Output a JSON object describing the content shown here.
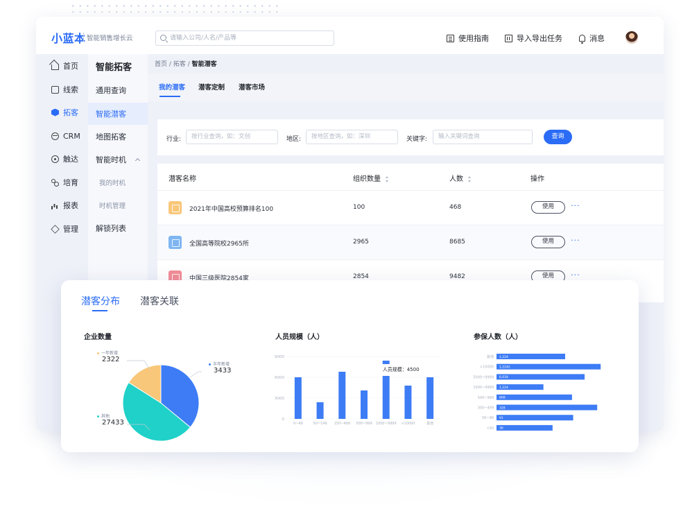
{
  "app": {
    "logo": "小蓝本",
    "subtitle": "智能销售增长云",
    "search_placeholder": "请输入公司/人名/产品等"
  },
  "toolbar": {
    "guide": "使用指南",
    "export": "导入导出任务",
    "messages": "消息"
  },
  "nav": {
    "items": [
      {
        "label": "首页",
        "icon": "home-icon"
      },
      {
        "label": "线索",
        "icon": "clue-icon"
      },
      {
        "label": "拓客",
        "icon": "prospect-icon",
        "active": true
      },
      {
        "label": "CRM",
        "icon": "crm-icon"
      },
      {
        "label": "触达",
        "icon": "reach-icon"
      },
      {
        "label": "培育",
        "icon": "nurture-icon"
      },
      {
        "label": "报表",
        "icon": "report-icon"
      },
      {
        "label": "管理",
        "icon": "manage-icon"
      }
    ]
  },
  "subnav": {
    "title": "智能拓客",
    "items": [
      "通用查询",
      "智能潜客",
      "地图拓客",
      "智能时机",
      "我的时机",
      "时机管理",
      "解锁列表"
    ]
  },
  "breadcrumb": {
    "home": "首页",
    "sep": "/",
    "parent": "拓客",
    "current": "智能潜客"
  },
  "tabs": [
    "我的潜客",
    "潜客定制",
    "潜客市场"
  ],
  "filters": {
    "industry_label": "行业:",
    "industry_placeholder": "按行业查询，如：文创",
    "region_label": "地区:",
    "region_placeholder": "按地区查询，如：深圳",
    "keyword_label": "关键字:",
    "keyword_placeholder": "输入关键词查询",
    "search_button": "查询"
  },
  "table": {
    "headers": [
      "潜客名称",
      "组织数量",
      "人数",
      "操作"
    ],
    "rows": [
      {
        "name": "2021年中国高校预算排名100",
        "orgs": "100",
        "people": "468",
        "action": "使用",
        "more": "···",
        "color": "#f9c77a"
      },
      {
        "name": "全国高等院校2965所",
        "orgs": "2965",
        "people": "8685",
        "action": "使用",
        "more": "···",
        "color": "#7fb6f2"
      },
      {
        "name": "中国三级医院2854家",
        "orgs": "2854",
        "people": "9482",
        "action": "使用",
        "more": "···",
        "color": "#f28d96"
      }
    ]
  },
  "dist": {
    "tabs": [
      "潜客分布",
      "潜客关联"
    ],
    "pie_title": "企业数量",
    "bar_title": "人员规模（人）",
    "hbar_title": "参保人数（人）"
  },
  "chart_data": [
    {
      "type": "pie",
      "title": "企业数量",
      "slices": [
        {
          "name": "一年新增",
          "value": 2322,
          "color": "#f9c77a"
        },
        {
          "name": "半年新增",
          "value": 3433,
          "color": "#3d7cf5"
        },
        {
          "name": "其他",
          "value": 27433,
          "color": "#1fd1c8"
        }
      ]
    },
    {
      "type": "bar",
      "title": "人员规模（人）",
      "categories": [
        "0~49",
        "50~149",
        "150~499",
        "500~999",
        "1000~9999",
        ">10000",
        "其他"
      ],
      "values": [
        6000,
        2400,
        6800,
        4100,
        6200,
        4800,
        6000
      ],
      "ylim": [
        0,
        9000
      ],
      "yticks": [
        "9000",
        "6000",
        "3000",
        "0"
      ],
      "tooltip": {
        "category": "1000~9999",
        "text": "人员规模：4500"
      },
      "color": "#3d7cf5"
    },
    {
      "type": "bar",
      "orientation": "horizontal",
      "title": "参保人数（人）",
      "categories": [
        "其他",
        ">10000",
        "5000~9999",
        "1000~4999",
        "500~999",
        "300~499",
        "50~99",
        "<50"
      ],
      "labels": [
        "1,224",
        "1,2242",
        "6,034",
        "1,224",
        "808",
        "328",
        "91",
        "36"
      ],
      "values": [
        0.6,
        0.91,
        0.77,
        0.41,
        0.66,
        0.88,
        0.67,
        0.49
      ],
      "color": "#3d7cf5"
    }
  ]
}
